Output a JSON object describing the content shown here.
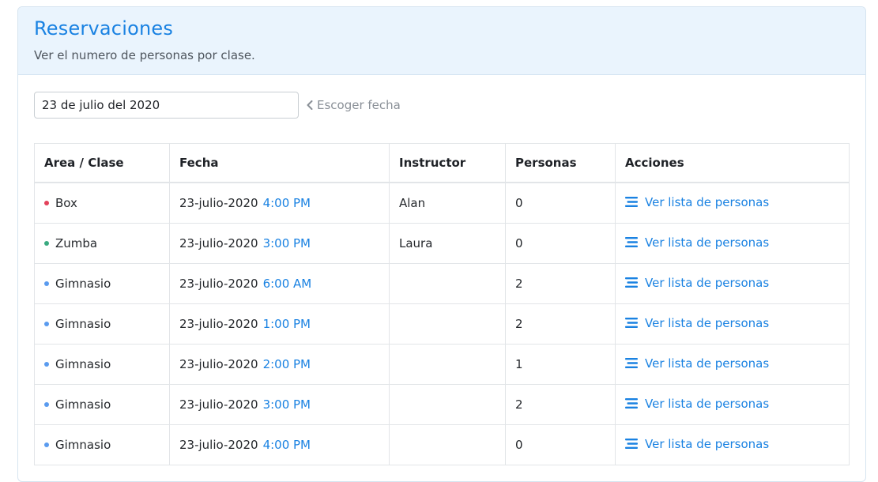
{
  "header": {
    "title": "Reservaciones",
    "subtitle": "Ver el numero de personas por clase."
  },
  "date_filter": {
    "value": "23 de julio del 2020",
    "pick_label": "Escoger fecha"
  },
  "table": {
    "columns": [
      "Area / Clase",
      "Fecha",
      "Instructor",
      "Personas",
      "Acciones"
    ],
    "rows": [
      {
        "area": "Box",
        "dot_color": "#e3425b",
        "date": "23-julio-2020",
        "time": "4:00 PM",
        "instructor": "Alan",
        "people": "0",
        "action": "Ver lista de personas"
      },
      {
        "area": "Zumba",
        "dot_color": "#3aaa80",
        "date": "23-julio-2020",
        "time": "3:00 PM",
        "instructor": "Laura",
        "people": "0",
        "action": "Ver lista de personas"
      },
      {
        "area": "Gimnasio",
        "dot_color": "#5a9bef",
        "date": "23-julio-2020",
        "time": "6:00 AM",
        "instructor": "",
        "people": "2",
        "action": "Ver lista de personas"
      },
      {
        "area": "Gimnasio",
        "dot_color": "#5a9bef",
        "date": "23-julio-2020",
        "time": "1:00 PM",
        "instructor": "",
        "people": "2",
        "action": "Ver lista de personas"
      },
      {
        "area": "Gimnasio",
        "dot_color": "#5a9bef",
        "date": "23-julio-2020",
        "time": "2:00 PM",
        "instructor": "",
        "people": "1",
        "action": "Ver lista de personas"
      },
      {
        "area": "Gimnasio",
        "dot_color": "#5a9bef",
        "date": "23-julio-2020",
        "time": "3:00 PM",
        "instructor": "",
        "people": "2",
        "action": "Ver lista de personas"
      },
      {
        "area": "Gimnasio",
        "dot_color": "#5a9bef",
        "date": "23-julio-2020",
        "time": "4:00 PM",
        "instructor": "",
        "people": "0",
        "action": "Ver lista de personas"
      }
    ]
  },
  "icons": {
    "pick_date": "chevron-left-icon",
    "action": "list-icon"
  },
  "colors": {
    "accent": "#1a82e2",
    "header_bg": "#eaf4fd"
  }
}
